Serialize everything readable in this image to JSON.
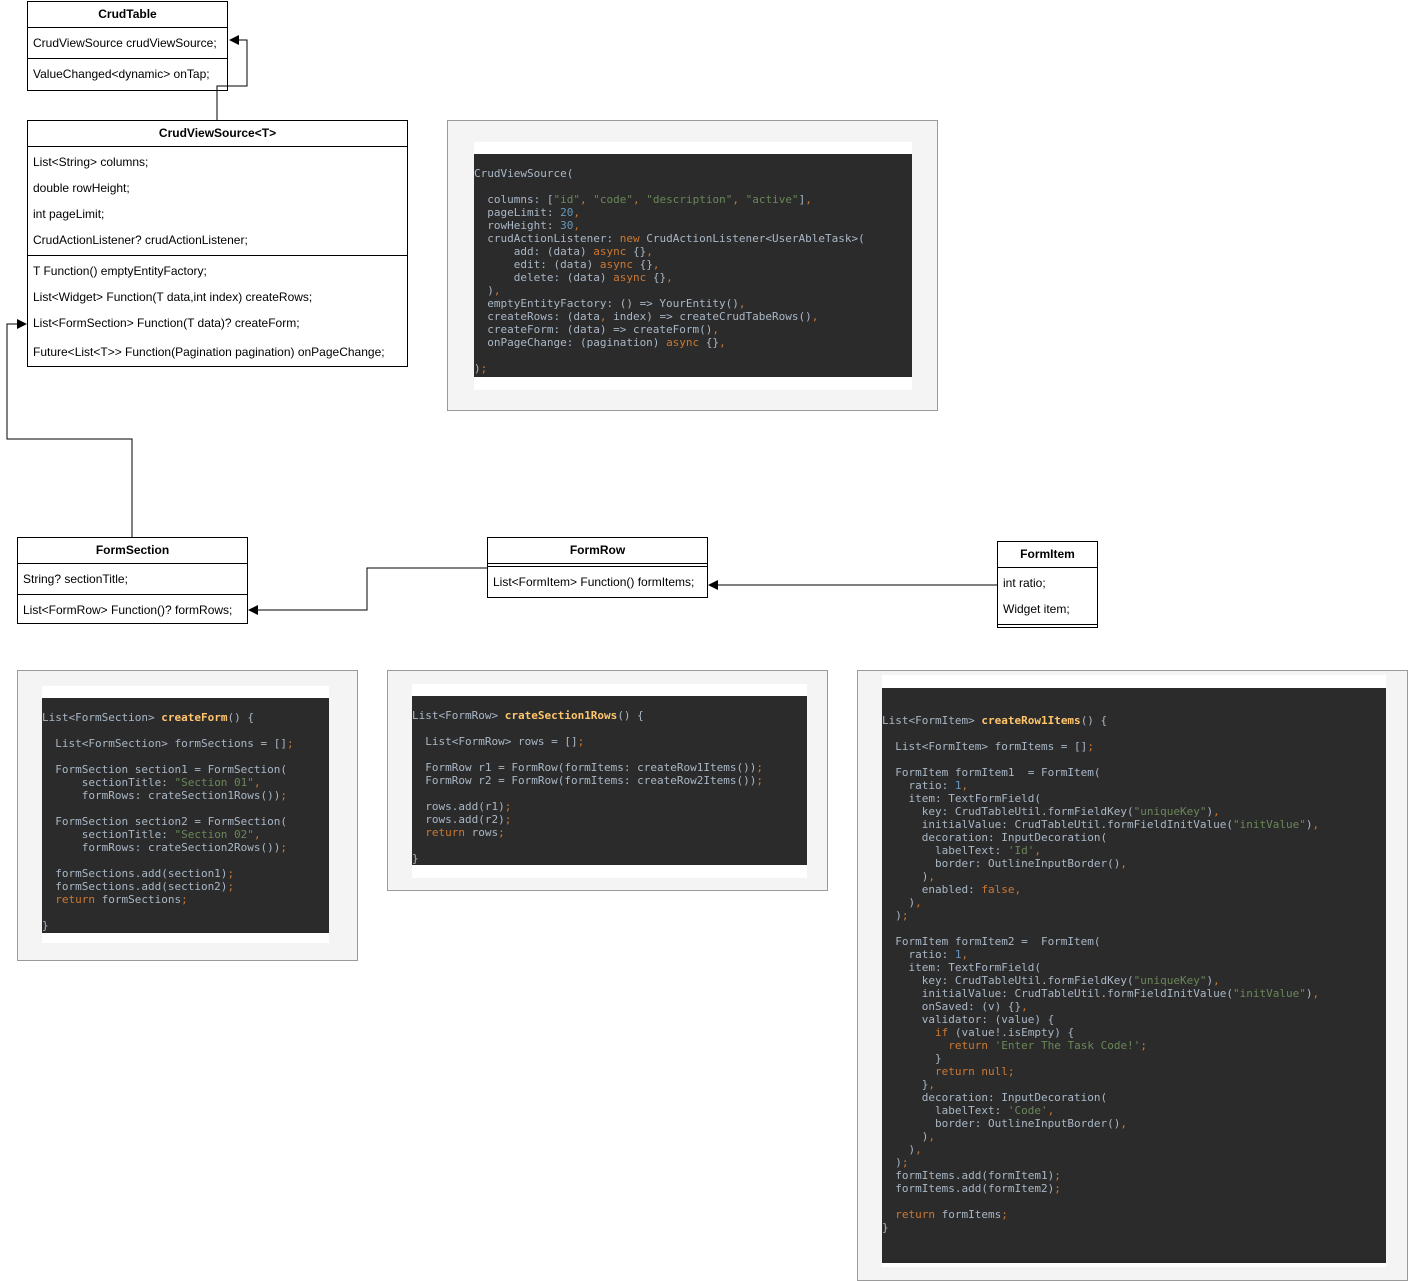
{
  "classes": {
    "crud_table": {
      "name": "CrudTable",
      "attributes": [
        "CrudViewSource crudViewSource;"
      ],
      "methods": [
        "ValueChanged<dynamic> onTap;"
      ]
    },
    "crud_view_source": {
      "name": "CrudViewSource<T>",
      "attributes": [
        "List<String> columns;",
        "double rowHeight;",
        "int pageLimit;",
        "CrudActionListener? crudActionListener;"
      ],
      "methods": [
        "T Function() emptyEntityFactory;",
        "List<Widget> Function(T data,int index) createRows;",
        "List<FormSection> Function(T data)? createForm;",
        "Future<List<T>> Function(Pagination pagination) onPageChange;"
      ]
    },
    "form_section": {
      "name": "FormSection",
      "attributes": [
        "String? sectionTitle;"
      ],
      "methods": [
        "List<FormRow> Function()? formRows;"
      ]
    },
    "form_row": {
      "name": "FormRow",
      "attributes": [],
      "methods": [
        "List<FormItem> Function() formItems;"
      ]
    },
    "form_item": {
      "name": "FormItem",
      "attributes": [
        "int ratio;",
        "Widget item;"
      ],
      "methods": []
    }
  },
  "code_blocks": [
    {
      "name": "crud-view-source-snippet",
      "lines": [
        "",
        "CrudViewSource(",
        "",
        "  columns: [\"id\", \"code\", \"description\", \"active\"],",
        "  pageLimit: 20,",
        "  rowHeight: 30,",
        "  crudActionListener: new CrudActionListener<UserAbleTask>(",
        "      add: (data) async {},",
        "      edit: (data) async {},",
        "      delete: (data) async {},",
        "  ),",
        "  emptyEntityFactory: () => YourEntity(),",
        "  createRows: (data, index) => createCrudTabeRows(),",
        "  createForm: (data) => createForm(),",
        "  onPageChange: (pagination) async {},",
        "",
        ");"
      ]
    },
    {
      "name": "create-form-snippet",
      "lines": [
        "",
        "List<FormSection> createForm() {",
        "",
        "  List<FormSection> formSections = [];",
        "",
        "  FormSection section1 = FormSection(",
        "      sectionTitle: \"Section 01\",",
        "      formRows: crateSection1Rows());",
        "",
        "  FormSection section2 = FormSection(",
        "      sectionTitle: \"Section 02\",",
        "      formRows: crateSection2Rows());",
        "",
        "  formSections.add(section1);",
        "  formSections.add(section2);",
        "  return formSections;",
        "",
        "}"
      ]
    },
    {
      "name": "crate-section-rows-snippet",
      "lines": [
        "",
        "List<FormRow> crateSection1Rows() {",
        "",
        "  List<FormRow> rows = [];",
        "",
        "  FormRow r1 = FormRow(formItems: createRow1Items());",
        "  FormRow r2 = FormRow(formItems: createRow2Items());",
        "",
        "  rows.add(r1);",
        "  rows.add(r2);",
        "  return rows;",
        "",
        "}"
      ]
    },
    {
      "name": "create-row-items-snippet",
      "lines": [
        "",
        "",
        "List<FormItem> createRow1Items() {",
        "",
        "  List<FormItem> formItems = [];",
        "",
        "  FormItem formItem1  = FormItem(",
        "    ratio: 1,",
        "    item: TextFormField(",
        "      key: CrudTableUtil.formFieldKey(\"uniqueKey\"),",
        "      initialValue: CrudTableUtil.formFieldInitValue(\"initValue\"),",
        "      decoration: InputDecoration(",
        "        labelText: 'Id',",
        "        border: OutlineInputBorder(),",
        "      ),",
        "      enabled: false,",
        "    ),",
        "  );",
        "",
        "  FormItem formItem2 =  FormItem(",
        "    ratio: 1,",
        "    item: TextFormField(",
        "      key: CrudTableUtil.formFieldKey(\"uniqueKey\"),",
        "      initialValue: CrudTableUtil.formFieldInitValue(\"initValue\"),",
        "      onSaved: (v) {},",
        "      validator: (value) {",
        "        if (value!.isEmpty) {",
        "          return 'Enter The Task Code!';",
        "        }",
        "        return null;",
        "      },",
        "      decoration: InputDecoration(",
        "        labelText: 'Code',",
        "        border: OutlineInputBorder(),",
        "      ),",
        "    ),",
        "  );",
        "  formItems.add(formItem1);",
        "  formItems.add(formItem2);",
        "",
        "  return formItems;",
        "}"
      ]
    }
  ],
  "colors": {
    "code_background": "#2b2b2b",
    "code_text": "#a9b7c6",
    "code_keyword": "#cc7832",
    "code_string": "#6a8759",
    "code_number": "#6897bb",
    "code_function": "#ffc66d",
    "panel_background": "#f4f4f4"
  }
}
